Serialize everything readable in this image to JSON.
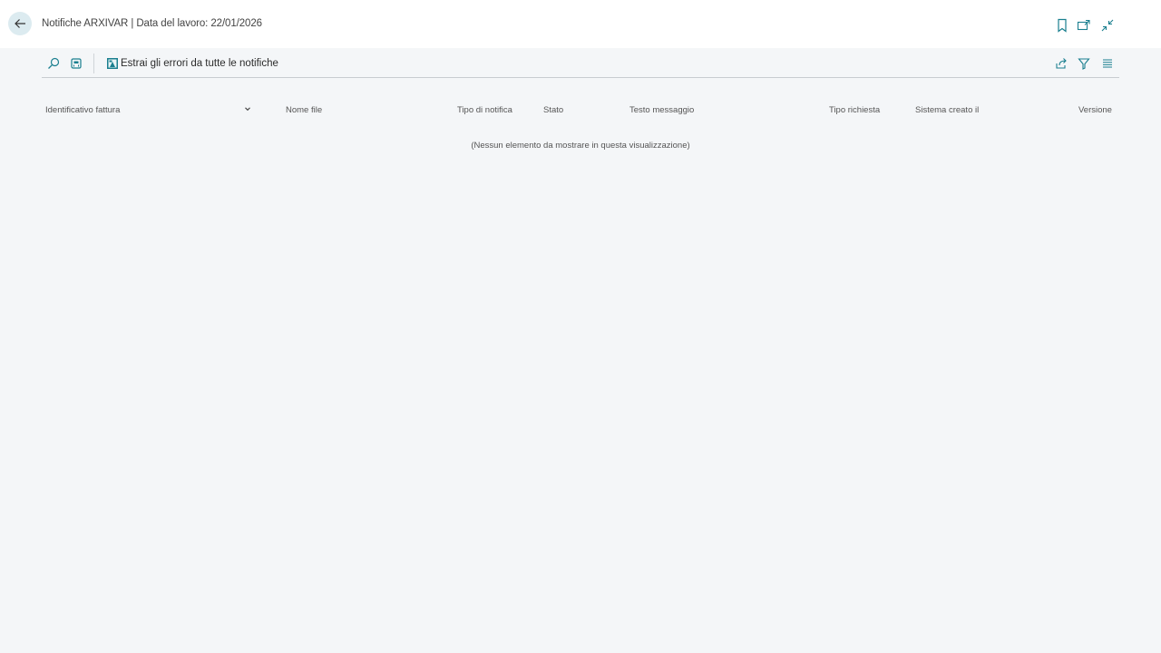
{
  "header": {
    "title": "Notifiche ARXIVAR | Data del lavoro: 22/01/2026",
    "back_icon": "arrow-left-icon",
    "right_icons": [
      "bookmark-icon",
      "open-new-window-icon",
      "collapse-icon"
    ]
  },
  "toolbar": {
    "search_icon": "search-icon",
    "view_icon": "view-layout-icon",
    "action_label": "Estrai gli errori da tutte le notifiche",
    "action_icon": "extract-errors-icon",
    "right_icons": [
      "share-icon",
      "filter-icon",
      "list-view-icon"
    ]
  },
  "table": {
    "columns": [
      "Identificativo fattura",
      "Nome file",
      "Tipo di notifica",
      "Stato",
      "Testo messaggio",
      "Tipo richiesta",
      "Sistema creato il",
      "Versione"
    ],
    "empty_message": "(Nessun elemento da mostrare in questa visualizzazione)"
  },
  "colors": {
    "accent": "#1a7f8f",
    "background": "#f4f6f8",
    "header_bg": "#ffffff"
  }
}
